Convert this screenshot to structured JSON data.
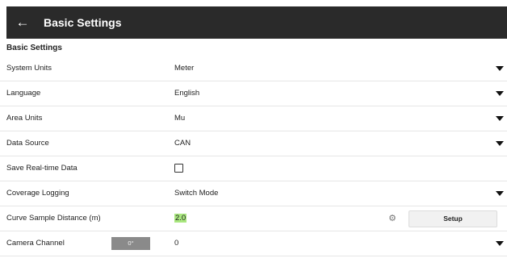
{
  "header": {
    "title": "Basic Settings",
    "back_icon": "arrow-left-icon"
  },
  "section_title": "Basic Settings",
  "rows": [
    {
      "label": "System Units",
      "value": "Meter"
    },
    {
      "label": "Language",
      "value": "English"
    },
    {
      "label": "Area Units",
      "value": "Mu"
    },
    {
      "label": "Data Source",
      "value": "CAN"
    },
    {
      "label": "Save Real-time Data",
      "checked": false
    },
    {
      "label": "Coverage Logging",
      "value": "Switch Mode"
    },
    {
      "label": "Curve Sample Distance (m)",
      "value": "2.0",
      "button": "Setup",
      "icon": "gear-icon"
    },
    {
      "label": "Camera Channel",
      "value": "0",
      "angle": "0°"
    }
  ],
  "colors": {
    "topbar": "#2a2a2a",
    "highlight": "#a9e77f"
  }
}
